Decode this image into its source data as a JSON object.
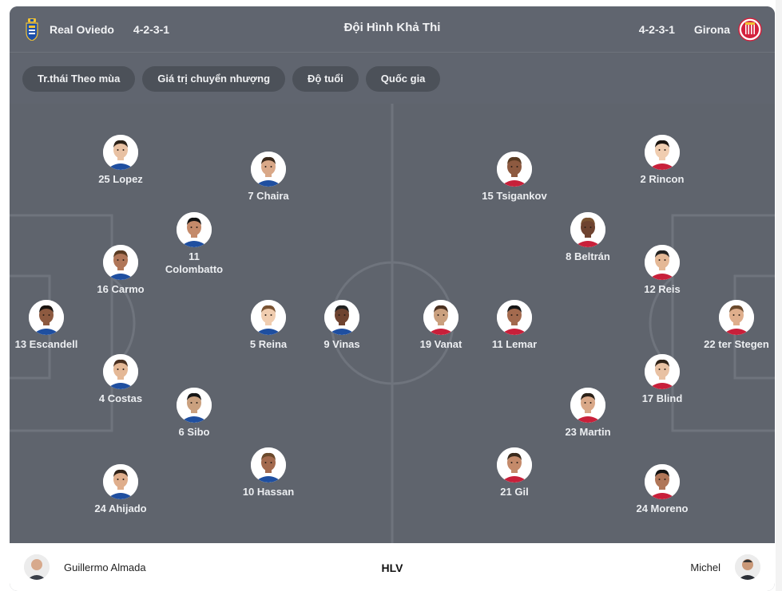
{
  "header": {
    "title": "Đội Hình Khả Thi",
    "home": {
      "name": "Real Oviedo",
      "formation": "4-2-3-1",
      "crest_icon": "real-oviedo-crest-icon"
    },
    "away": {
      "name": "Girona",
      "formation": "4-2-3-1",
      "crest_icon": "girona-crest-icon"
    }
  },
  "filters": [
    "Tr.thái Theo mùa",
    "Giá trị chuyển nhượng",
    "Độ tuổi",
    "Quốc gia"
  ],
  "home_players": [
    {
      "number": "25",
      "name": "Lopez"
    },
    {
      "number": "7",
      "name": "Chaira"
    },
    {
      "number": "11",
      "name": "Colombatto"
    },
    {
      "number": "16",
      "name": "Carmo"
    },
    {
      "number": "13",
      "name": "Escandell"
    },
    {
      "number": "5",
      "name": "Reina"
    },
    {
      "number": "9",
      "name": "Vinas"
    },
    {
      "number": "4",
      "name": "Costas"
    },
    {
      "number": "6",
      "name": "Sibo"
    },
    {
      "number": "10",
      "name": "Hassan"
    },
    {
      "number": "24",
      "name": "Ahijado"
    }
  ],
  "away_players": [
    {
      "number": "15",
      "name": "Tsigankov"
    },
    {
      "number": "2",
      "name": "Rincon"
    },
    {
      "number": "8",
      "name": "Beltrán"
    },
    {
      "number": "12",
      "name": "Reis"
    },
    {
      "number": "19",
      "name": "Vanat"
    },
    {
      "number": "11",
      "name": "Lemar"
    },
    {
      "number": "22",
      "name": "ter Stegen"
    },
    {
      "number": "17",
      "name": "Blind"
    },
    {
      "number": "23",
      "name": "Martin"
    },
    {
      "number": "21",
      "name": "Gil"
    },
    {
      "number": "24",
      "name": "Moreno"
    }
  ],
  "footer": {
    "label": "HLV",
    "home_coach": "Guillermo Almada",
    "away_coach": "Michel"
  },
  "colors": {
    "pitch": "#5f646d",
    "lines": "#6f747d",
    "chip": "#4c5159",
    "text": "#eceef1"
  }
}
